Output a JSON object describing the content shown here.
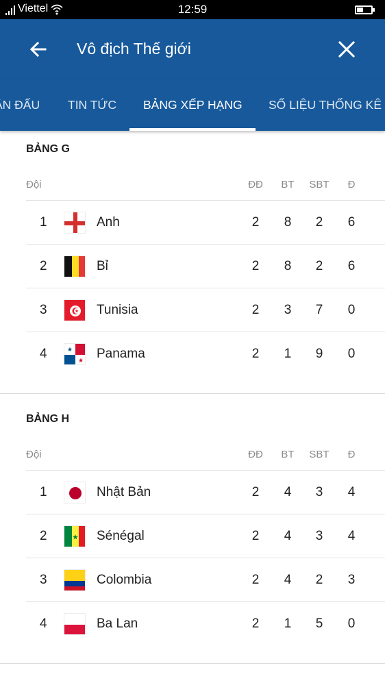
{
  "status_bar": {
    "carrier": "Viettel",
    "time": "12:59"
  },
  "app_bar": {
    "title": "Vô địch Thế giới",
    "back_icon": "arrow-left-icon",
    "close_icon": "close-icon"
  },
  "tabs": [
    {
      "label": "ẬN ĐẤU",
      "active": false
    },
    {
      "label": "TIN TỨC",
      "active": false
    },
    {
      "label": "BẢNG XẾP HẠNG",
      "active": true
    },
    {
      "label": "SỐ LIỆU THỐNG KÊ",
      "active": false
    }
  ],
  "columns": {
    "team": "Đội",
    "played": "ĐĐ",
    "goals_for": "BT",
    "goals_against": "SBT",
    "points": "Đ"
  },
  "groups": [
    {
      "title": "BẢNG G",
      "rows": [
        {
          "rank": "1",
          "flag": "england-flag-icon",
          "team": "Anh",
          "played": "2",
          "goals_for": "8",
          "goals_against": "2",
          "points": "6"
        },
        {
          "rank": "2",
          "flag": "belgium-flag-icon",
          "team": "Bỉ",
          "played": "2",
          "goals_for": "8",
          "goals_against": "2",
          "points": "6"
        },
        {
          "rank": "3",
          "flag": "tunisia-flag-icon",
          "team": "Tunisia",
          "played": "2",
          "goals_for": "3",
          "goals_against": "7",
          "points": "0"
        },
        {
          "rank": "4",
          "flag": "panama-flag-icon",
          "team": "Panama",
          "played": "2",
          "goals_for": "1",
          "goals_against": "9",
          "points": "0"
        }
      ]
    },
    {
      "title": "BẢNG H",
      "rows": [
        {
          "rank": "1",
          "flag": "japan-flag-icon",
          "team": "Nhật Bản",
          "played": "2",
          "goals_for": "4",
          "goals_against": "3",
          "points": "4"
        },
        {
          "rank": "2",
          "flag": "senegal-flag-icon",
          "team": "Sénégal",
          "played": "2",
          "goals_for": "4",
          "goals_against": "3",
          "points": "4"
        },
        {
          "rank": "3",
          "flag": "colombia-flag-icon",
          "team": "Colombia",
          "played": "2",
          "goals_for": "4",
          "goals_against": "2",
          "points": "3"
        },
        {
          "rank": "4",
          "flag": "poland-flag-icon",
          "team": "Ba Lan",
          "played": "2",
          "goals_for": "1",
          "goals_against": "5",
          "points": "0"
        }
      ]
    }
  ],
  "colors": {
    "app_bar": "#17599b",
    "indicator": "#ffffff"
  }
}
